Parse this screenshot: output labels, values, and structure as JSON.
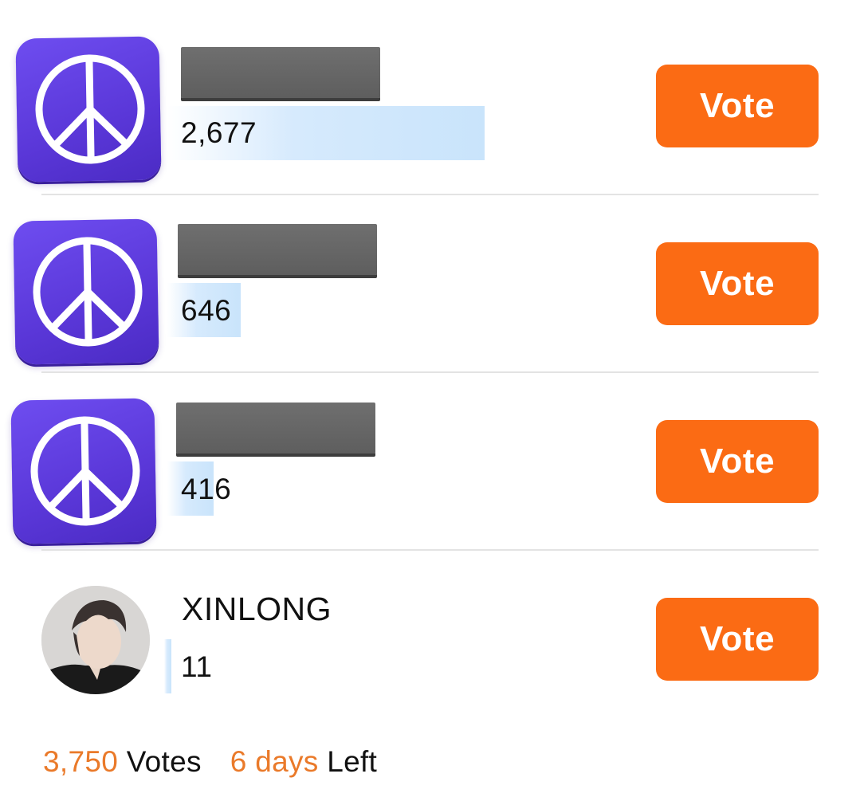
{
  "theme": {
    "accent": "#ea7a2a",
    "button": "#fb6b14",
    "icon": "#5a37d8",
    "bar": "#c9e4fb"
  },
  "candidates": [
    {
      "icon": "peace-icon",
      "name_redacted": true,
      "votes": "2,677",
      "vote_label": "Vote",
      "share": 0.714
    },
    {
      "icon": "peace-icon",
      "name_redacted": true,
      "votes": "646",
      "vote_label": "Vote",
      "share": 0.172
    },
    {
      "icon": "peace-icon",
      "name_redacted": true,
      "votes": "416",
      "vote_label": "Vote",
      "share": 0.111
    },
    {
      "icon": "avatar",
      "name": "XINLONG",
      "votes": "11",
      "vote_label": "Vote",
      "share": 0.003
    }
  ],
  "footer": {
    "total_votes": "3,750",
    "votes_label": "Votes",
    "days_left": "6 days",
    "left_label": "Left"
  }
}
